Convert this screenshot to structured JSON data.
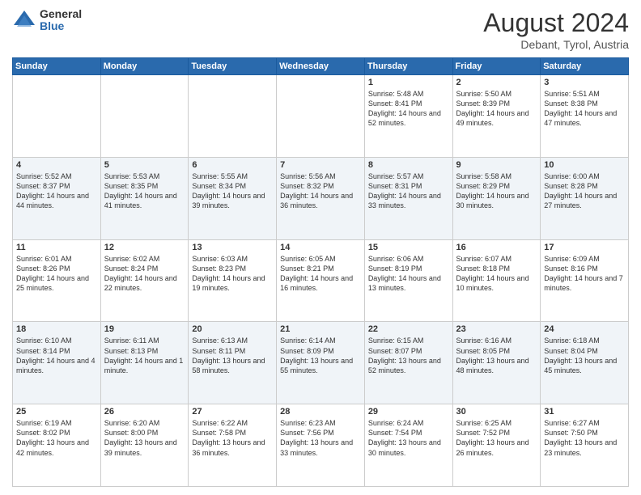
{
  "header": {
    "logo_general": "General",
    "logo_blue": "Blue",
    "month_year": "August 2024",
    "location": "Debant, Tyrol, Austria"
  },
  "weekdays": [
    "Sunday",
    "Monday",
    "Tuesday",
    "Wednesday",
    "Thursday",
    "Friday",
    "Saturday"
  ],
  "weeks": [
    [
      {
        "day": "",
        "info": ""
      },
      {
        "day": "",
        "info": ""
      },
      {
        "day": "",
        "info": ""
      },
      {
        "day": "",
        "info": ""
      },
      {
        "day": "1",
        "info": "Sunrise: 5:48 AM\nSunset: 8:41 PM\nDaylight: 14 hours and 52 minutes."
      },
      {
        "day": "2",
        "info": "Sunrise: 5:50 AM\nSunset: 8:39 PM\nDaylight: 14 hours and 49 minutes."
      },
      {
        "day": "3",
        "info": "Sunrise: 5:51 AM\nSunset: 8:38 PM\nDaylight: 14 hours and 47 minutes."
      }
    ],
    [
      {
        "day": "4",
        "info": "Sunrise: 5:52 AM\nSunset: 8:37 PM\nDaylight: 14 hours and 44 minutes."
      },
      {
        "day": "5",
        "info": "Sunrise: 5:53 AM\nSunset: 8:35 PM\nDaylight: 14 hours and 41 minutes."
      },
      {
        "day": "6",
        "info": "Sunrise: 5:55 AM\nSunset: 8:34 PM\nDaylight: 14 hours and 39 minutes."
      },
      {
        "day": "7",
        "info": "Sunrise: 5:56 AM\nSunset: 8:32 PM\nDaylight: 14 hours and 36 minutes."
      },
      {
        "day": "8",
        "info": "Sunrise: 5:57 AM\nSunset: 8:31 PM\nDaylight: 14 hours and 33 minutes."
      },
      {
        "day": "9",
        "info": "Sunrise: 5:58 AM\nSunset: 8:29 PM\nDaylight: 14 hours and 30 minutes."
      },
      {
        "day": "10",
        "info": "Sunrise: 6:00 AM\nSunset: 8:28 PM\nDaylight: 14 hours and 27 minutes."
      }
    ],
    [
      {
        "day": "11",
        "info": "Sunrise: 6:01 AM\nSunset: 8:26 PM\nDaylight: 14 hours and 25 minutes."
      },
      {
        "day": "12",
        "info": "Sunrise: 6:02 AM\nSunset: 8:24 PM\nDaylight: 14 hours and 22 minutes."
      },
      {
        "day": "13",
        "info": "Sunrise: 6:03 AM\nSunset: 8:23 PM\nDaylight: 14 hours and 19 minutes."
      },
      {
        "day": "14",
        "info": "Sunrise: 6:05 AM\nSunset: 8:21 PM\nDaylight: 14 hours and 16 minutes."
      },
      {
        "day": "15",
        "info": "Sunrise: 6:06 AM\nSunset: 8:19 PM\nDaylight: 14 hours and 13 minutes."
      },
      {
        "day": "16",
        "info": "Sunrise: 6:07 AM\nSunset: 8:18 PM\nDaylight: 14 hours and 10 minutes."
      },
      {
        "day": "17",
        "info": "Sunrise: 6:09 AM\nSunset: 8:16 PM\nDaylight: 14 hours and 7 minutes."
      }
    ],
    [
      {
        "day": "18",
        "info": "Sunrise: 6:10 AM\nSunset: 8:14 PM\nDaylight: 14 hours and 4 minutes."
      },
      {
        "day": "19",
        "info": "Sunrise: 6:11 AM\nSunset: 8:13 PM\nDaylight: 14 hours and 1 minute."
      },
      {
        "day": "20",
        "info": "Sunrise: 6:13 AM\nSunset: 8:11 PM\nDaylight: 13 hours and 58 minutes."
      },
      {
        "day": "21",
        "info": "Sunrise: 6:14 AM\nSunset: 8:09 PM\nDaylight: 13 hours and 55 minutes."
      },
      {
        "day": "22",
        "info": "Sunrise: 6:15 AM\nSunset: 8:07 PM\nDaylight: 13 hours and 52 minutes."
      },
      {
        "day": "23",
        "info": "Sunrise: 6:16 AM\nSunset: 8:05 PM\nDaylight: 13 hours and 48 minutes."
      },
      {
        "day": "24",
        "info": "Sunrise: 6:18 AM\nSunset: 8:04 PM\nDaylight: 13 hours and 45 minutes."
      }
    ],
    [
      {
        "day": "25",
        "info": "Sunrise: 6:19 AM\nSunset: 8:02 PM\nDaylight: 13 hours and 42 minutes."
      },
      {
        "day": "26",
        "info": "Sunrise: 6:20 AM\nSunset: 8:00 PM\nDaylight: 13 hours and 39 minutes."
      },
      {
        "day": "27",
        "info": "Sunrise: 6:22 AM\nSunset: 7:58 PM\nDaylight: 13 hours and 36 minutes."
      },
      {
        "day": "28",
        "info": "Sunrise: 6:23 AM\nSunset: 7:56 PM\nDaylight: 13 hours and 33 minutes."
      },
      {
        "day": "29",
        "info": "Sunrise: 6:24 AM\nSunset: 7:54 PM\nDaylight: 13 hours and 30 minutes."
      },
      {
        "day": "30",
        "info": "Sunrise: 6:25 AM\nSunset: 7:52 PM\nDaylight: 13 hours and 26 minutes."
      },
      {
        "day": "31",
        "info": "Sunrise: 6:27 AM\nSunset: 7:50 PM\nDaylight: 13 hours and 23 minutes."
      }
    ]
  ]
}
